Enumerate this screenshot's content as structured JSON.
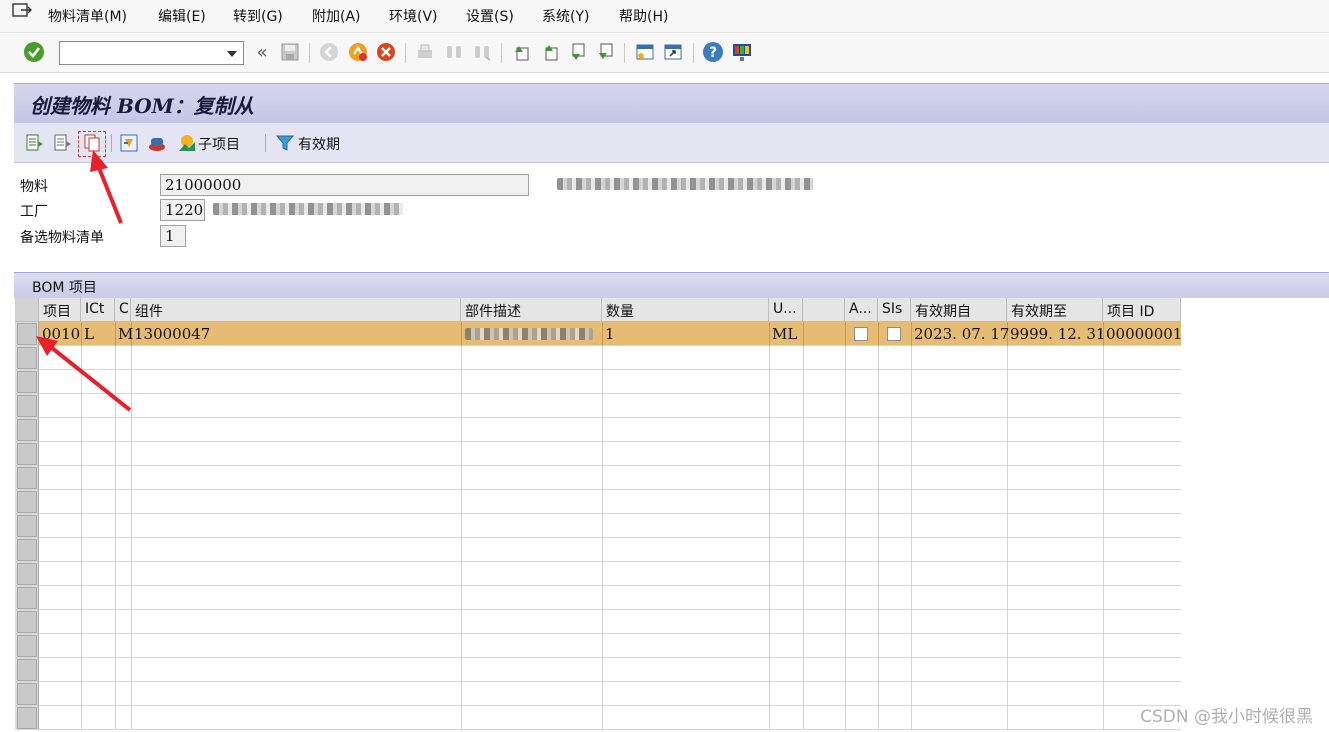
{
  "menu": [
    "物料清单(M)",
    "编辑(E)",
    "转到(G)",
    "附加(A)",
    "环境(V)",
    "设置(S)",
    "系统(Y)",
    "帮助(H)"
  ],
  "command_field": {
    "value": ""
  },
  "title": "创建物料 BOM：复制从",
  "app_toolbar": {
    "subitems_label": "子项目",
    "validity_label": "有效期"
  },
  "header": {
    "material_label": "物料",
    "material_value": "21000000",
    "plant_label": "工厂",
    "plant_value": "1220",
    "alt_bom_label": "备选物料清单",
    "alt_bom_value": "1"
  },
  "bom": {
    "section_title": "BOM 项目",
    "columns": [
      "项目",
      "ICt",
      "C",
      "组件",
      "部件描述",
      "数量",
      "U...",
      "",
      "A...",
      "SIs",
      "有效期自",
      "有效期至",
      "项目 ID"
    ],
    "rows": [
      {
        "item": "0010",
        "ict": "L",
        "c": "M",
        "component": "13000047",
        "quantity": "1",
        "unit": "ML",
        "valid_from": "2023. 07. 17",
        "valid_to": "9999. 12. 31",
        "item_id": "00000001"
      }
    ],
    "total_visible_rows": 17
  },
  "colors": {
    "title_bg": "#c8cae8",
    "selected_row": "#e6bc74",
    "annotation_arrow": "#e8202a"
  },
  "watermark": "CSDN @我小时候很黑"
}
